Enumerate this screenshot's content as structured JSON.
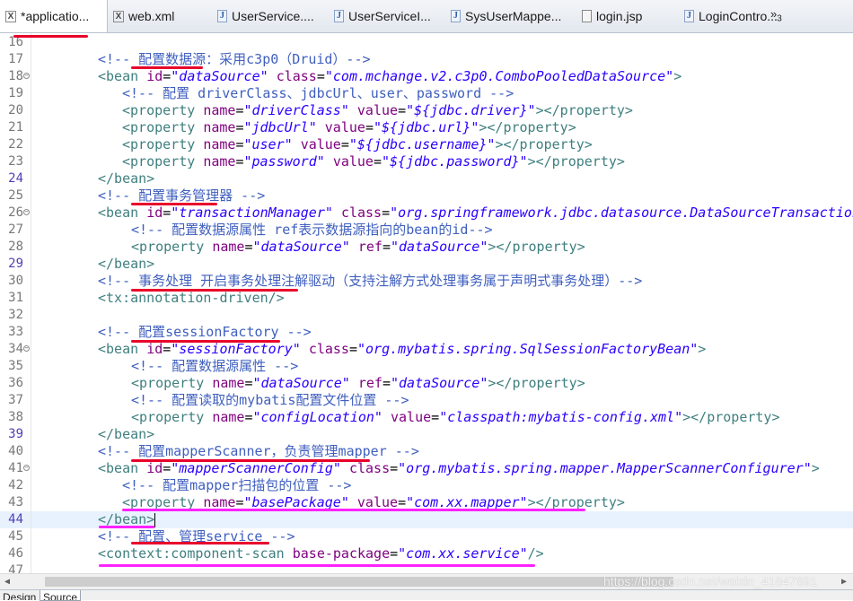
{
  "tabs": [
    {
      "label": "*applicatio...",
      "icon": "xml-file-icon",
      "icon_glyph": "X",
      "active": true
    },
    {
      "label": "web.xml",
      "icon": "xml-file-icon",
      "icon_glyph": "X"
    },
    {
      "label": "UserService....",
      "icon": "java-file-icon",
      "icon_glyph": "J"
    },
    {
      "label": "UserServiceI...",
      "icon": "java-file-icon",
      "icon_glyph": "J"
    },
    {
      "label": "SysUserMappe...",
      "icon": "java-file-icon",
      "icon_glyph": "J"
    },
    {
      "label": "login.jsp",
      "icon": "jsp-file-icon",
      "icon_glyph": ""
    },
    {
      "label": "LoginContro...",
      "icon": "java-file-icon",
      "icon_glyph": "J"
    }
  ],
  "tab_overflow": {
    "chevron": "»",
    "count": "3"
  },
  "lines": [
    {
      "n": "16",
      "tokens": []
    },
    {
      "n": "17",
      "tokens": [
        {
          "t": "<!-- 配置数据源：采用c3p0（Druid）-->",
          "c": "com"
        }
      ]
    },
    {
      "n": "18",
      "fold": true,
      "tokens": [
        {
          "t": "<bean ",
          "c": "tag"
        },
        {
          "t": "id",
          "c": "att"
        },
        {
          "t": "=",
          "c": "eq"
        },
        {
          "t": "\"dataSource\"",
          "c": "val"
        },
        {
          "t": " ",
          "c": "tag"
        },
        {
          "t": "class",
          "c": "att"
        },
        {
          "t": "=",
          "c": "eq"
        },
        {
          "t": "\"com.mchange.v2.c3p0.ComboPooledDataSource\"",
          "c": "val"
        },
        {
          "t": ">",
          "c": "tag"
        }
      ]
    },
    {
      "n": "19",
      "indent": "i1",
      "tokens": [
        {
          "t": "<!-- 配置 driverClass、jdbcUrl、user、password -->",
          "c": "com"
        }
      ]
    },
    {
      "n": "20",
      "indent": "i1",
      "tokens": [
        {
          "t": "<property ",
          "c": "tag"
        },
        {
          "t": "name",
          "c": "att"
        },
        {
          "t": "=",
          "c": "eq"
        },
        {
          "t": "\"driverClass\"",
          "c": "val"
        },
        {
          "t": " ",
          "c": "tag"
        },
        {
          "t": "value",
          "c": "att"
        },
        {
          "t": "=",
          "c": "eq"
        },
        {
          "t": "\"${jdbc.driver}\"",
          "c": "val"
        },
        {
          "t": "></property>",
          "c": "tag"
        }
      ]
    },
    {
      "n": "21",
      "indent": "i1",
      "tokens": [
        {
          "t": "<property ",
          "c": "tag"
        },
        {
          "t": "name",
          "c": "att"
        },
        {
          "t": "=",
          "c": "eq"
        },
        {
          "t": "\"jdbcUrl\"",
          "c": "val"
        },
        {
          "t": " ",
          "c": "tag"
        },
        {
          "t": "value",
          "c": "att"
        },
        {
          "t": "=",
          "c": "eq"
        },
        {
          "t": "\"${jdbc.url}\"",
          "c": "val"
        },
        {
          "t": "></property>",
          "c": "tag"
        }
      ]
    },
    {
      "n": "22",
      "indent": "i1",
      "tokens": [
        {
          "t": "<property ",
          "c": "tag"
        },
        {
          "t": "name",
          "c": "att"
        },
        {
          "t": "=",
          "c": "eq"
        },
        {
          "t": "\"user\"",
          "c": "val"
        },
        {
          "t": " ",
          "c": "tag"
        },
        {
          "t": "value",
          "c": "att"
        },
        {
          "t": "=",
          "c": "eq"
        },
        {
          "t": "\"${jdbc.username}\"",
          "c": "val"
        },
        {
          "t": "></property>",
          "c": "tag"
        }
      ]
    },
    {
      "n": "23",
      "indent": "i1",
      "tokens": [
        {
          "t": "<property ",
          "c": "tag"
        },
        {
          "t": "name",
          "c": "att"
        },
        {
          "t": "=",
          "c": "eq"
        },
        {
          "t": "\"password\"",
          "c": "val"
        },
        {
          "t": " ",
          "c": "tag"
        },
        {
          "t": "value",
          "c": "att"
        },
        {
          "t": "=",
          "c": "eq"
        },
        {
          "t": "\"${jdbc.password}\"",
          "c": "val"
        },
        {
          "t": "></property>",
          "c": "tag"
        }
      ]
    },
    {
      "n": "24",
      "mark": true,
      "tokens": [
        {
          "t": "</bean>",
          "c": "tag"
        }
      ]
    },
    {
      "n": "25",
      "tokens": [
        {
          "t": "<!-- 配置事务管理器 -->",
          "c": "com"
        }
      ]
    },
    {
      "n": "26",
      "fold": true,
      "tokens": [
        {
          "t": "<bean ",
          "c": "tag"
        },
        {
          "t": "id",
          "c": "att"
        },
        {
          "t": "=",
          "c": "eq"
        },
        {
          "t": "\"transactionManager\"",
          "c": "val"
        },
        {
          "t": " ",
          "c": "tag"
        },
        {
          "t": "class",
          "c": "att"
        },
        {
          "t": "=",
          "c": "eq"
        },
        {
          "t": "\"org.springframework.jdbc.datasource.DataSourceTransaction",
          "c": "val"
        }
      ]
    },
    {
      "n": "27",
      "indent": "i2",
      "tokens": [
        {
          "t": "<!-- 配置数据源属性 ref表示数据源指向的bean的id-->",
          "c": "com"
        }
      ]
    },
    {
      "n": "28",
      "indent": "i2",
      "tokens": [
        {
          "t": "<property ",
          "c": "tag"
        },
        {
          "t": "name",
          "c": "att"
        },
        {
          "t": "=",
          "c": "eq"
        },
        {
          "t": "\"dataSource\"",
          "c": "val"
        },
        {
          "t": " ",
          "c": "tag"
        },
        {
          "t": "ref",
          "c": "att"
        },
        {
          "t": "=",
          "c": "eq"
        },
        {
          "t": "\"dataSource\"",
          "c": "val"
        },
        {
          "t": "></property>",
          "c": "tag"
        }
      ]
    },
    {
      "n": "29",
      "mark": true,
      "tokens": [
        {
          "t": "</bean>",
          "c": "tag"
        }
      ]
    },
    {
      "n": "30",
      "tokens": [
        {
          "t": "<!-- 事务处理 开启事务处理注解驱动（支持注解方式处理事务属于声明式事务处理）-->",
          "c": "com"
        }
      ]
    },
    {
      "n": "31",
      "tokens": [
        {
          "t": "<tx:annotation-driven/>",
          "c": "tag"
        }
      ]
    },
    {
      "n": "32",
      "tokens": []
    },
    {
      "n": "33",
      "tokens": [
        {
          "t": "<!-- 配置sessionFactory -->",
          "c": "com"
        }
      ]
    },
    {
      "n": "34",
      "fold": true,
      "tokens": [
        {
          "t": "<bean ",
          "c": "tag"
        },
        {
          "t": "id",
          "c": "att"
        },
        {
          "t": "=",
          "c": "eq"
        },
        {
          "t": "\"sessionFactory\"",
          "c": "val"
        },
        {
          "t": " ",
          "c": "tag"
        },
        {
          "t": "class",
          "c": "att"
        },
        {
          "t": "=",
          "c": "eq"
        },
        {
          "t": "\"org.mybatis.spring.SqlSessionFactoryBean\"",
          "c": "val"
        },
        {
          "t": ">",
          "c": "tag"
        }
      ]
    },
    {
      "n": "35",
      "indent": "i2",
      "tokens": [
        {
          "t": "<!-- 配置数据源属性 -->",
          "c": "com"
        }
      ]
    },
    {
      "n": "36",
      "indent": "i2",
      "tokens": [
        {
          "t": "<property ",
          "c": "tag"
        },
        {
          "t": "name",
          "c": "att"
        },
        {
          "t": "=",
          "c": "eq"
        },
        {
          "t": "\"dataSource\"",
          "c": "val"
        },
        {
          "t": " ",
          "c": "tag"
        },
        {
          "t": "ref",
          "c": "att"
        },
        {
          "t": "=",
          "c": "eq"
        },
        {
          "t": "\"dataSource\"",
          "c": "val"
        },
        {
          "t": "></property>",
          "c": "tag"
        }
      ]
    },
    {
      "n": "37",
      "indent": "i2",
      "tokens": [
        {
          "t": "<!-- 配置读取的mybatis配置文件位置 -->",
          "c": "com"
        }
      ]
    },
    {
      "n": "38",
      "indent": "i2",
      "tokens": [
        {
          "t": "<property ",
          "c": "tag"
        },
        {
          "t": "name",
          "c": "att"
        },
        {
          "t": "=",
          "c": "eq"
        },
        {
          "t": "\"configLocation\"",
          "c": "val"
        },
        {
          "t": " ",
          "c": "tag"
        },
        {
          "t": "value",
          "c": "att"
        },
        {
          "t": "=",
          "c": "eq"
        },
        {
          "t": "\"classpath:mybatis-config.xml\"",
          "c": "val"
        },
        {
          "t": "></property>",
          "c": "tag"
        }
      ]
    },
    {
      "n": "39",
      "mark": true,
      "tokens": [
        {
          "t": "</bean>",
          "c": "tag"
        }
      ]
    },
    {
      "n": "40",
      "tokens": [
        {
          "t": "<!-- 配置mapperScanner，负责管理mapper -->",
          "c": "com"
        }
      ]
    },
    {
      "n": "41",
      "fold": true,
      "tokens": [
        {
          "t": "<bean ",
          "c": "tag"
        },
        {
          "t": "id",
          "c": "att"
        },
        {
          "t": "=",
          "c": "eq"
        },
        {
          "t": "\"mapperScannerConfig\"",
          "c": "val"
        },
        {
          "t": " ",
          "c": "tag"
        },
        {
          "t": "class",
          "c": "att"
        },
        {
          "t": "=",
          "c": "eq"
        },
        {
          "t": "\"org.mybatis.spring.mapper.MapperScannerConfigurer\"",
          "c": "val"
        },
        {
          "t": ">",
          "c": "tag"
        }
      ]
    },
    {
      "n": "42",
      "indent": "i1",
      "tokens": [
        {
          "t": "<!-- 配置mapper扫描包的位置 -->",
          "c": "com"
        }
      ]
    },
    {
      "n": "43",
      "indent": "i1",
      "tokens": [
        {
          "t": "<property ",
          "c": "tag"
        },
        {
          "t": "name",
          "c": "att"
        },
        {
          "t": "=",
          "c": "eq"
        },
        {
          "t": "\"basePackage\"",
          "c": "val"
        },
        {
          "t": " ",
          "c": "tag"
        },
        {
          "t": "value",
          "c": "att"
        },
        {
          "t": "=",
          "c": "eq"
        },
        {
          "t": "\"com.xx.mapper\"",
          "c": "val"
        },
        {
          "t": "></property>",
          "c": "tag"
        }
      ]
    },
    {
      "n": "44",
      "mark": true,
      "current": true,
      "tokens": [
        {
          "t": "</bean>",
          "c": "tag"
        }
      ]
    },
    {
      "n": "45",
      "tokens": [
        {
          "t": "<!-- 配置、管理service -->",
          "c": "com"
        }
      ]
    },
    {
      "n": "46",
      "tokens": [
        {
          "t": "<context:component-scan ",
          "c": "tag"
        },
        {
          "t": "base-package",
          "c": "att"
        },
        {
          "t": "=",
          "c": "eq"
        },
        {
          "t": "\"com.xx.service\"",
          "c": "val"
        },
        {
          "t": "/>",
          "c": "tag"
        }
      ]
    },
    {
      "n": "47",
      "tokens": []
    }
  ],
  "watermark": "https://blog.csdn.net/weixin_41847891",
  "bottom_tabs": [
    "Design",
    "Source"
  ],
  "colors": {
    "comment": "#3f5fbf",
    "tag": "#3f7f7f",
    "attribute": "#7f007f",
    "value": "#2a00ff",
    "annotation_red": "#e8002b",
    "annotation_magenta": "#ff22ff"
  }
}
